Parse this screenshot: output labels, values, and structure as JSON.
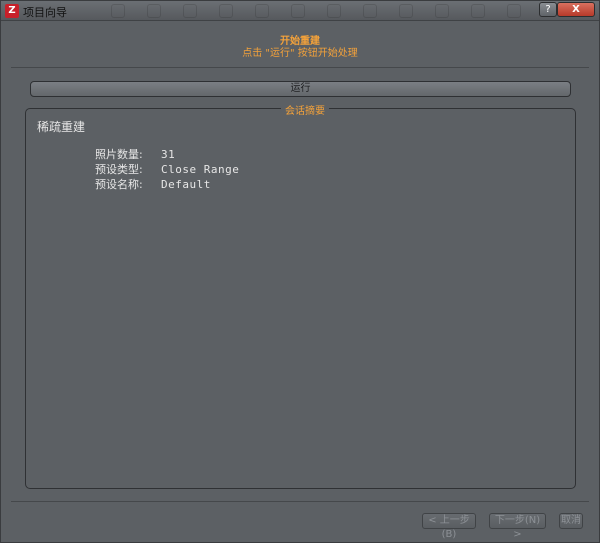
{
  "window": {
    "icon_letter": "Z",
    "title": "项目向导",
    "help_label": "?",
    "close_label": "X"
  },
  "header": {
    "title": "开始重建",
    "subtitle": "点击 \"运行\" 按钮开始处理"
  },
  "run_button": {
    "label": "运行"
  },
  "summary": {
    "group_label": "会话摘要",
    "heading": "稀疏重建",
    "rows": [
      {
        "label": "照片数量:",
        "value": "31"
      },
      {
        "label": "预设类型:",
        "value": "Close Range"
      },
      {
        "label": "预设名称:",
        "value": "Default"
      }
    ]
  },
  "footer": {
    "prev_label": "< 上一步(B)",
    "next_label": "下一步(N) >",
    "cancel_label": "取消"
  },
  "colors": {
    "accent": "#f4a23a",
    "window_bg": "#5c6064",
    "close_button": "#c44a38"
  }
}
